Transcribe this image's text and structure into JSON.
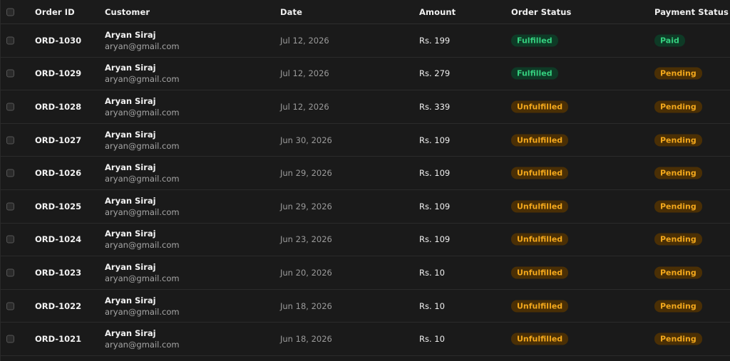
{
  "colors": {
    "background": "#1a1a1a",
    "green_badge_bg": "#0e3a26",
    "green_badge_text": "#35d07f",
    "amber_badge_bg": "#4a2f05",
    "amber_badge_text": "#f3a81c"
  },
  "header": {
    "order_id": "Order ID",
    "customer": "Customer",
    "date": "Date",
    "amount": "Amount",
    "order_status": "Order Status",
    "payment_status": "Payment Status"
  },
  "rows": [
    {
      "id": "ORD-1030",
      "name": "Aryan Siraj",
      "email": "aryan@gmail.com",
      "date": "Jul 12, 2026",
      "amount": "Rs. 199",
      "order_status": "Fulfilled",
      "order_status_tone": "green",
      "payment_status": "Paid",
      "payment_status_tone": "green"
    },
    {
      "id": "ORD-1029",
      "name": "Aryan Siraj",
      "email": "aryan@gmail.com",
      "date": "Jul 12, 2026",
      "amount": "Rs. 279",
      "order_status": "Fulfilled",
      "order_status_tone": "green",
      "payment_status": "Pending",
      "payment_status_tone": "amber"
    },
    {
      "id": "ORD-1028",
      "name": "Aryan Siraj",
      "email": "aryan@gmail.com",
      "date": "Jul 12, 2026",
      "amount": "Rs. 339",
      "order_status": "Unfulfilled",
      "order_status_tone": "amber",
      "payment_status": "Pending",
      "payment_status_tone": "amber"
    },
    {
      "id": "ORD-1027",
      "name": "Aryan Siraj",
      "email": "aryan@gmail.com",
      "date": "Jun 30, 2026",
      "amount": "Rs. 109",
      "order_status": "Unfulfilled",
      "order_status_tone": "amber",
      "payment_status": "Pending",
      "payment_status_tone": "amber"
    },
    {
      "id": "ORD-1026",
      "name": "Aryan Siraj",
      "email": "aryan@gmail.com",
      "date": "Jun 29, 2026",
      "amount": "Rs. 109",
      "order_status": "Unfulfilled",
      "order_status_tone": "amber",
      "payment_status": "Pending",
      "payment_status_tone": "amber"
    },
    {
      "id": "ORD-1025",
      "name": "Aryan Siraj",
      "email": "aryan@gmail.com",
      "date": "Jun 29, 2026",
      "amount": "Rs. 109",
      "order_status": "Unfulfilled",
      "order_status_tone": "amber",
      "payment_status": "Pending",
      "payment_status_tone": "amber"
    },
    {
      "id": "ORD-1024",
      "name": "Aryan Siraj",
      "email": "aryan@gmail.com",
      "date": "Jun 23, 2026",
      "amount": "Rs. 109",
      "order_status": "Unfulfilled",
      "order_status_tone": "amber",
      "payment_status": "Pending",
      "payment_status_tone": "amber"
    },
    {
      "id": "ORD-1023",
      "name": "Aryan Siraj",
      "email": "aryan@gmail.com",
      "date": "Jun 20, 2026",
      "amount": "Rs. 10",
      "order_status": "Unfulfilled",
      "order_status_tone": "amber",
      "payment_status": "Pending",
      "payment_status_tone": "amber"
    },
    {
      "id": "ORD-1022",
      "name": "Aryan Siraj",
      "email": "aryan@gmail.com",
      "date": "Jun 18, 2026",
      "amount": "Rs. 10",
      "order_status": "Unfulfilled",
      "order_status_tone": "amber",
      "payment_status": "Pending",
      "payment_status_tone": "amber"
    },
    {
      "id": "ORD-1021",
      "name": "Aryan Siraj",
      "email": "aryan@gmail.com",
      "date": "Jun 18, 2026",
      "amount": "Rs. 10",
      "order_status": "Unfulfilled",
      "order_status_tone": "amber",
      "payment_status": "Pending",
      "payment_status_tone": "amber"
    }
  ]
}
